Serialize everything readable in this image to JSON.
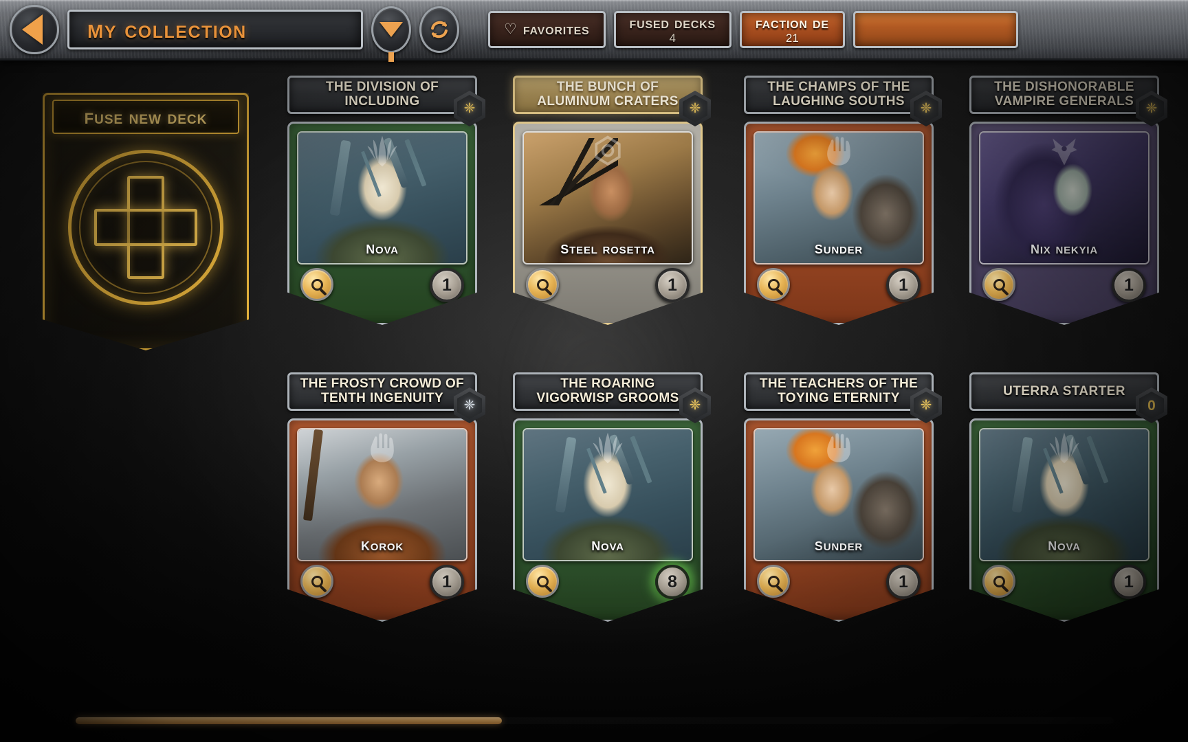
{
  "header": {
    "back_icon": "back-arrow-icon",
    "title": "My Collection",
    "filter_icon": "funnel-filter-icon",
    "refresh_icon": "refresh-icon",
    "tabs": [
      {
        "icon": "heart-icon",
        "label": "Favorites",
        "count": "",
        "style": "dark"
      },
      {
        "icon": "",
        "label": "Fused Decks",
        "count": "4",
        "style": "dark"
      },
      {
        "icon": "",
        "label": "Faction De",
        "count": "21",
        "style": "bright"
      },
      {
        "icon": "",
        "label": "",
        "count": "",
        "style": "empty"
      }
    ]
  },
  "fuse_card": {
    "label": "Fuse New Deck",
    "icon": "plus-icon"
  },
  "decks": [
    {
      "title": "The Division of Including",
      "hero": "Nova",
      "faction": "green",
      "art": "nova",
      "count": "1",
      "rarity": "gold",
      "rarity_glyph": "❈",
      "selected": false,
      "glow": false,
      "magnifier_icon": "magnifier-icon"
    },
    {
      "title": "The Bunch of Aluminum Craters",
      "hero": "Steel Rosetta",
      "faction": "steel",
      "art": "rosetta",
      "count": "1",
      "rarity": "gold",
      "rarity_glyph": "❈",
      "selected": true,
      "glow": false,
      "magnifier_icon": "magnifier-icon"
    },
    {
      "title": "The Champs of the Laughing Souths",
      "hero": "Sunder",
      "faction": "red",
      "art": "sunder",
      "count": "1",
      "rarity": "gold",
      "rarity_glyph": "❈",
      "selected": false,
      "glow": false,
      "magnifier_icon": "magnifier-icon"
    },
    {
      "title": "The Dishonorable Vampire Generals",
      "hero": "Nix Nekyia",
      "faction": "purple",
      "art": "nix",
      "count": "1",
      "rarity": "gold",
      "rarity_glyph": "❈",
      "selected": false,
      "glow": false,
      "magnifier_icon": "magnifier-icon"
    },
    {
      "title": "The Frosty Crowd of Tenth Ingenuity",
      "hero": "Korok",
      "faction": "red",
      "art": "korok",
      "count": "1",
      "rarity": "silver",
      "rarity_glyph": "❈",
      "selected": false,
      "glow": false,
      "magnifier_icon": "magnifier-icon"
    },
    {
      "title": "The Roaring Vigorwisp Grooms",
      "hero": "Nova",
      "faction": "green",
      "art": "nova",
      "count": "8",
      "rarity": "gold",
      "rarity_glyph": "❈",
      "selected": false,
      "glow": true,
      "magnifier_icon": "magnifier-icon"
    },
    {
      "title": "The Teachers of the Toying Eternity",
      "hero": "Sunder",
      "faction": "red",
      "art": "sunder",
      "count": "1",
      "rarity": "gold",
      "rarity_glyph": "❈",
      "selected": false,
      "glow": false,
      "magnifier_icon": "magnifier-icon"
    },
    {
      "title": "Uterra Starter",
      "hero": "Nova",
      "faction": "green",
      "art": "nova",
      "count": "1",
      "rarity": "zero",
      "rarity_glyph": "0",
      "selected": false,
      "glow": false,
      "magnifier_icon": "magnifier-icon"
    }
  ],
  "scrollbar": {
    "name": "horizontal-scrollbar"
  }
}
